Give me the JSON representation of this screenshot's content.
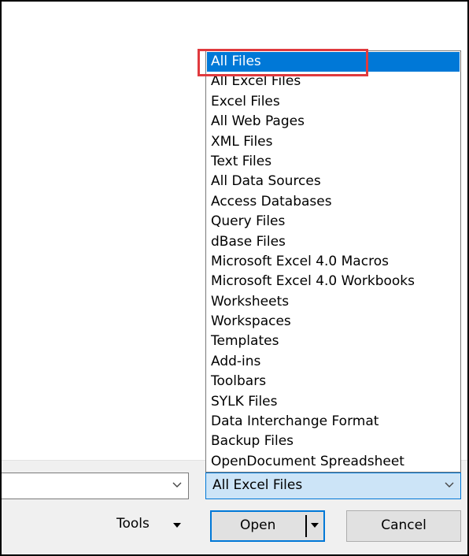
{
  "dropdown": {
    "options": [
      "All Files",
      "All Excel Files",
      "Excel Files",
      "All Web Pages",
      "XML Files",
      "Text Files",
      "All Data Sources",
      "Access Databases",
      "Query Files",
      "dBase Files",
      "Microsoft Excel 4.0 Macros",
      "Microsoft Excel 4.0 Workbooks",
      "Worksheets",
      "Workspaces",
      "Templates",
      "Add-ins",
      "Toolbars",
      "SYLK Files",
      "Data Interchange Format",
      "Backup Files",
      "OpenDocument Spreadsheet"
    ],
    "selected_option": "All Files"
  },
  "file_type_combo": {
    "value": "All Excel Files"
  },
  "file_name_combo": {
    "value": ""
  },
  "buttons": {
    "tools_label": "Tools",
    "open_label": "Open",
    "cancel_label": "Cancel"
  },
  "colors": {
    "selection_blue": "#0078d7",
    "combo_highlight": "#cce4f7",
    "annotation_red": "#e03a3e",
    "button_face": "#e1e1e1",
    "dialog_band": "#f0f0f0"
  },
  "icons": {
    "combo_chevron": "chevron-down-icon",
    "tools_caret": "caret-down-icon",
    "split_arrow": "split-arrow-down-icon"
  }
}
